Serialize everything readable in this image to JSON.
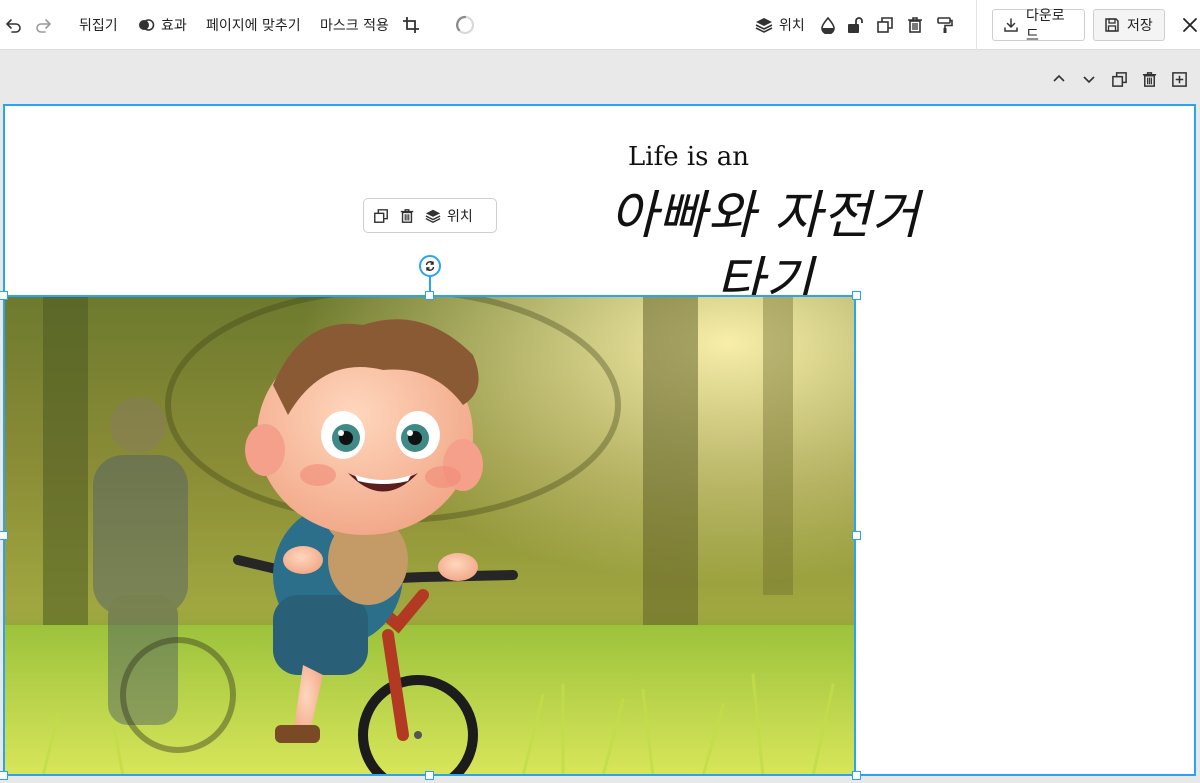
{
  "toolbar": {
    "undo_icon": "undo-icon",
    "redo_icon": "redo-icon",
    "flip_label": "뒤집기",
    "effect_label": "효과",
    "fit_page_label": "페이지에 맞추기",
    "mask_label": "마스크 적용",
    "crop_icon": "crop-icon",
    "loading_icon": "loading-spinner-icon",
    "position_label": "위치",
    "download_label": "다운로드",
    "save_label": "저장"
  },
  "canvas": {
    "title_en": "Life is an",
    "title_kr_line1": "아빠와 자전거",
    "title_kr_line2": "타기"
  },
  "context_menu": {
    "position_label": "위치"
  },
  "colors": {
    "accent": "#2aa3f0",
    "toolbar_bg": "#ffffff",
    "workspace_bg": "#e9e9e9"
  }
}
